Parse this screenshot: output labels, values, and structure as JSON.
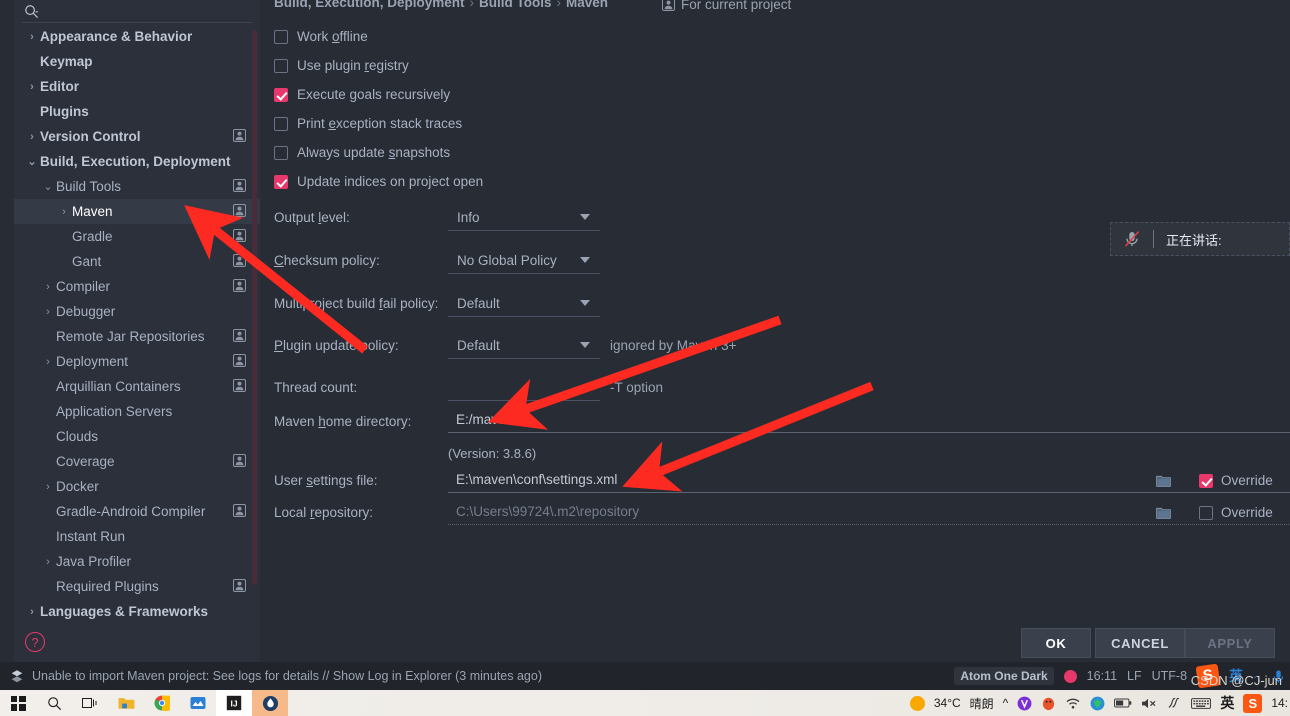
{
  "dialog": {
    "search": {
      "placeholder": ""
    },
    "sidebar": {
      "items": [
        {
          "label": "Appearance & Behavior",
          "indent": 0,
          "arrow": "›",
          "bold": true,
          "profile": false,
          "selected": false
        },
        {
          "label": "Keymap",
          "indent": 0,
          "arrow": "",
          "bold": true,
          "profile": false,
          "selected": false
        },
        {
          "label": "Editor",
          "indent": 0,
          "arrow": "›",
          "bold": true,
          "profile": false,
          "selected": false
        },
        {
          "label": "Plugins",
          "indent": 0,
          "arrow": "",
          "bold": true,
          "profile": false,
          "selected": false
        },
        {
          "label": "Version Control",
          "indent": 0,
          "arrow": "›",
          "bold": true,
          "profile": true,
          "selected": false
        },
        {
          "label": "Build, Execution, Deployment",
          "indent": 0,
          "arrow": "⌄",
          "bold": true,
          "profile": false,
          "selected": false
        },
        {
          "label": "Build Tools",
          "indent": 1,
          "arrow": "⌄",
          "bold": false,
          "profile": true,
          "selected": false
        },
        {
          "label": "Maven",
          "indent": 2,
          "arrow": "›",
          "bold": false,
          "profile": true,
          "selected": true
        },
        {
          "label": "Gradle",
          "indent": 2,
          "arrow": "",
          "bold": false,
          "profile": true,
          "selected": false
        },
        {
          "label": "Gant",
          "indent": 2,
          "arrow": "",
          "bold": false,
          "profile": true,
          "selected": false
        },
        {
          "label": "Compiler",
          "indent": 1,
          "arrow": "›",
          "bold": false,
          "profile": true,
          "selected": false
        },
        {
          "label": "Debugger",
          "indent": 1,
          "arrow": "›",
          "bold": false,
          "profile": false,
          "selected": false
        },
        {
          "label": "Remote Jar Repositories",
          "indent": 1,
          "arrow": "",
          "bold": false,
          "profile": true,
          "selected": false
        },
        {
          "label": "Deployment",
          "indent": 1,
          "arrow": "›",
          "bold": false,
          "profile": true,
          "selected": false
        },
        {
          "label": "Arquillian Containers",
          "indent": 1,
          "arrow": "",
          "bold": false,
          "profile": true,
          "selected": false
        },
        {
          "label": "Application Servers",
          "indent": 1,
          "arrow": "",
          "bold": false,
          "profile": false,
          "selected": false
        },
        {
          "label": "Clouds",
          "indent": 1,
          "arrow": "",
          "bold": false,
          "profile": false,
          "selected": false
        },
        {
          "label": "Coverage",
          "indent": 1,
          "arrow": "",
          "bold": false,
          "profile": true,
          "selected": false
        },
        {
          "label": "Docker",
          "indent": 1,
          "arrow": "›",
          "bold": false,
          "profile": false,
          "selected": false
        },
        {
          "label": "Gradle-Android Compiler",
          "indent": 1,
          "arrow": "",
          "bold": false,
          "profile": true,
          "selected": false
        },
        {
          "label": "Instant Run",
          "indent": 1,
          "arrow": "",
          "bold": false,
          "profile": false,
          "selected": false
        },
        {
          "label": "Java Profiler",
          "indent": 1,
          "arrow": "›",
          "bold": false,
          "profile": false,
          "selected": false
        },
        {
          "label": "Required Plugins",
          "indent": 1,
          "arrow": "",
          "bold": false,
          "profile": true,
          "selected": false
        },
        {
          "label": "Languages & Frameworks",
          "indent": 0,
          "arrow": "›",
          "bold": true,
          "profile": false,
          "selected": false
        }
      ]
    },
    "breadcrumb": {
      "part1": "Build, Execution, Deployment",
      "part2": "Build Tools",
      "part3": "Maven",
      "separator": "›"
    },
    "for_current_project": "For current project",
    "checkboxes": [
      {
        "label_pre": "Work ",
        "label_u": "o",
        "label_post": "ffline",
        "checked": false
      },
      {
        "label_pre": "Use plugin ",
        "label_u": "r",
        "label_post": "egistry",
        "checked": false
      },
      {
        "label_pre": "Execute ",
        "label_u": "g",
        "label_post": "oals recursively",
        "checked": true
      },
      {
        "label_pre": "Print ",
        "label_u": "e",
        "label_post": "xception stack traces",
        "checked": false
      },
      {
        "label_pre": "Always update ",
        "label_u": "s",
        "label_post": "napshots",
        "checked": false
      },
      {
        "label_pre": "Update indices on project open",
        "label_u": "",
        "label_post": "",
        "checked": true
      }
    ],
    "combos": [
      {
        "label_pre": "Output ",
        "label_u": "l",
        "label_post": "evel:",
        "value": "Info",
        "hint": ""
      },
      {
        "label_pre": "",
        "label_u": "C",
        "label_post": "hecksum policy:",
        "value": "No Global Policy",
        "hint": ""
      },
      {
        "label_pre": "Multiproject build ",
        "label_u": "f",
        "label_post": "ail policy:",
        "value": "Default",
        "hint": ""
      },
      {
        "label_pre": "",
        "label_u": "P",
        "label_post": "lugin update policy:",
        "value": "Default",
        "hint": "ignored by Maven 3+"
      },
      {
        "label_pre": "Thread count:",
        "label_u": "",
        "label_post": "",
        "value": "",
        "hint": "-T option"
      }
    ],
    "maven_home": {
      "label_pre": "Maven ",
      "label_u": "h",
      "label_post": "ome directory:",
      "value": "E:/maven",
      "browse_label": "...",
      "version_note": "(Version: 3.8.6)"
    },
    "user_settings": {
      "label_pre": "User ",
      "label_u": "s",
      "label_post": "ettings file:",
      "value": "E:\\maven\\conf\\settings.xml",
      "override_label": "Override",
      "override_checked": true
    },
    "local_repository": {
      "label_pre": "Local ",
      "label_u": "r",
      "label_post": "epository:",
      "value": "C:\\Users\\99724\\.m2\\repository",
      "override_label": "Override",
      "override_checked": false
    },
    "help_icon_label": "?",
    "buttons": {
      "ok": "OK",
      "cancel": "CANCEL",
      "apply": "APPLY"
    }
  },
  "toast": {
    "text": "正在讲话:",
    "icon": "mic-muted-icon"
  },
  "statusbar": {
    "message": "Unable to import Maven project: See logs for details // Show Log in Explorer (3 minutes ago)",
    "theme": "Atom One Dark",
    "time": "16:11",
    "line_sep": "LF",
    "encoding": "UTF-8",
    "ime_lang": "英",
    "ime_punct": "·,"
  },
  "taskbar": {
    "weather_temp": "34°C",
    "weather_desc": "晴朗",
    "clock": "14:",
    "ime_lang": "英",
    "watermark": "CSDN @CJ-jun"
  },
  "colors": {
    "accent_pink": "#e8386b",
    "bg": "#282c34",
    "sidebar_bg": "#2b303b",
    "arrow_red": "#fc2a20",
    "text": "#a9b2c3"
  }
}
